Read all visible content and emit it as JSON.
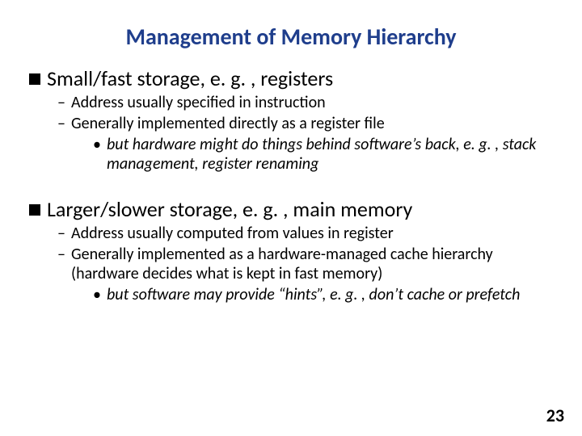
{
  "title": "Management of Memory Hierarchy",
  "section1": {
    "heading": "Small/fast storage, e. g. , registers",
    "bullets": [
      "Address usually specified in instruction",
      "Generally implemented directly as a register file"
    ],
    "sub": "but hardware might do things behind software’s back, e. g. , stack management, register renaming"
  },
  "section2": {
    "heading": "Larger/slower storage, e. g. , main memory",
    "bullets": [
      "Address usually computed from values in register",
      "Generally implemented as a hardware-managed cache hierarchy (hardware decides what is kept in fast memory)"
    ],
    "sub": "but software may provide “hints”, e. g. , don’t cache or prefetch"
  },
  "pagenum": "23"
}
